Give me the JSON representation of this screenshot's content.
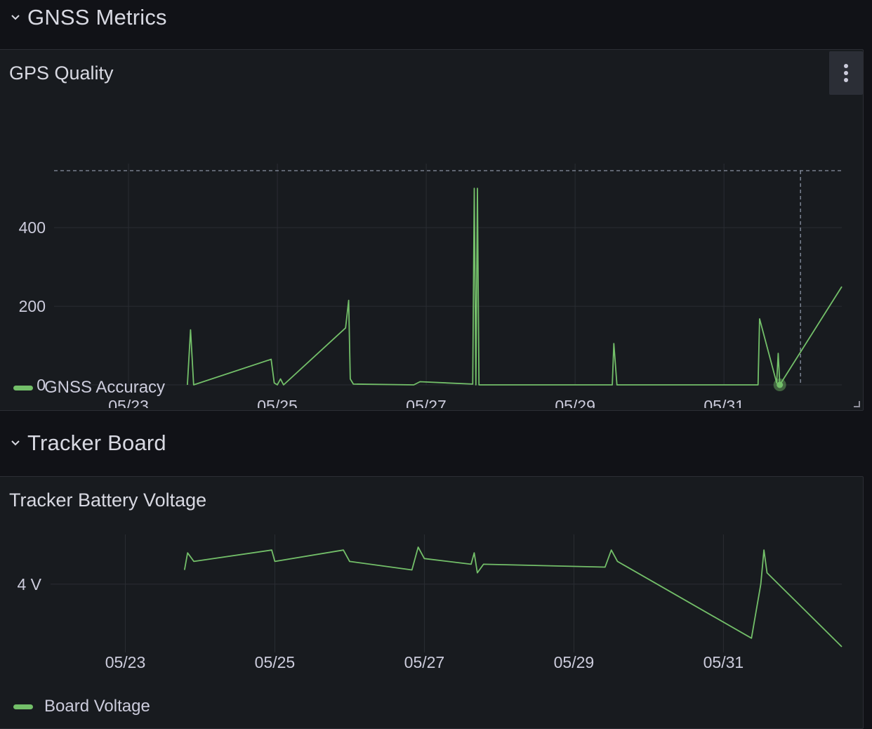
{
  "rows": [
    {
      "title": "GNSS Metrics"
    },
    {
      "title": "Tracker Board"
    }
  ],
  "panels": [
    {
      "title": "GPS Quality",
      "legend": "GNSS Accuracy"
    },
    {
      "title": "Tracker Battery Voltage",
      "legend": "Board Voltage"
    }
  ],
  "colors": {
    "background": "#111217",
    "panel": "#181b1f",
    "series": "#73bf69",
    "grid": "#2a2d33",
    "axis_text": "#ccccdc"
  },
  "icons": {
    "row_toggle": "chevron-down-icon",
    "panel_menu": "kebab-menu-icon"
  },
  "chart_data": [
    {
      "type": "line",
      "title": "GPS Quality",
      "x_ticks": [
        "05/23",
        "05/25",
        "05/27",
        "05/29",
        "05/31"
      ],
      "y_ticks": [
        "0",
        "200",
        "400"
      ],
      "ylim": [
        0,
        545
      ],
      "xlim": [
        "2023-05-22T00:00",
        "2023-06-01T14:00"
      ],
      "grid": true,
      "legend_position": "bottom-left",
      "threshold_dashed": 545,
      "hover_marker": {
        "x": "2023-05-31T18:00",
        "y": 0
      },
      "series": [
        {
          "name": "GNSS Accuracy",
          "points": [
            [
              "2023-05-23T19:00",
              0
            ],
            [
              "2023-05-23T20:00",
              140
            ],
            [
              "2023-05-23T21:00",
              0
            ],
            [
              "2023-05-24T22:00",
              65
            ],
            [
              "2023-05-24T23:00",
              5
            ],
            [
              "2023-05-25T00:00",
              0
            ],
            [
              "2023-05-25T01:00",
              15
            ],
            [
              "2023-05-25T02:00",
              0
            ],
            [
              "2023-05-25T22:00",
              145
            ],
            [
              "2023-05-25T23:00",
              215
            ],
            [
              "2023-05-25T23:30",
              15
            ],
            [
              "2023-05-26T00:30",
              2
            ],
            [
              "2023-05-26T20:00",
              0
            ],
            [
              "2023-05-26T22:00",
              8
            ],
            [
              "2023-05-27T15:00",
              2
            ],
            [
              "2023-05-27T15:30",
              500
            ],
            [
              "2023-05-27T16:00",
              0
            ],
            [
              "2023-05-27T16:30",
              500
            ],
            [
              "2023-05-27T17:00",
              0
            ],
            [
              "2023-05-29T12:00",
              0
            ],
            [
              "2023-05-29T12:30",
              105
            ],
            [
              "2023-05-29T13:30",
              0
            ],
            [
              "2023-05-31T11:00",
              0
            ],
            [
              "2023-05-31T11:30",
              168
            ],
            [
              "2023-05-31T17:00",
              5
            ],
            [
              "2023-05-31T17:30",
              80
            ],
            [
              "2023-05-31T18:00",
              0
            ],
            [
              "2023-06-01T14:00",
              250
            ]
          ]
        }
      ]
    },
    {
      "type": "line",
      "title": "Tracker Battery Voltage",
      "x_ticks": [
        "05/23",
        "05/25",
        "05/27",
        "05/29",
        "05/31"
      ],
      "y_ticks": [
        "4 V"
      ],
      "ylim": [
        3.76,
        4.15
      ],
      "xlim": [
        "2023-05-22T00:00",
        "2023-06-01T14:00"
      ],
      "grid": true,
      "legend_position": "bottom-left",
      "series": [
        {
          "name": "Board Voltage",
          "points": [
            [
              "2023-05-23T19:00",
              4.05
            ],
            [
              "2023-05-23T20:00",
              4.11
            ],
            [
              "2023-05-23T22:00",
              4.08
            ],
            [
              "2023-05-24T23:00",
              4.12
            ],
            [
              "2023-05-25T00:00",
              4.08
            ],
            [
              "2023-05-25T22:00",
              4.12
            ],
            [
              "2023-05-26T00:00",
              4.08
            ],
            [
              "2023-05-26T20:00",
              4.05
            ],
            [
              "2023-05-26T22:00",
              4.13
            ],
            [
              "2023-05-27T00:00",
              4.09
            ],
            [
              "2023-05-27T15:00",
              4.07
            ],
            [
              "2023-05-27T16:00",
              4.11
            ],
            [
              "2023-05-27T17:00",
              4.04
            ],
            [
              "2023-05-27T19:00",
              4.07
            ],
            [
              "2023-05-29T10:00",
              4.06
            ],
            [
              "2023-05-29T12:00",
              4.12
            ],
            [
              "2023-05-29T14:00",
              4.08
            ],
            [
              "2023-05-31T09:00",
              3.81
            ],
            [
              "2023-05-31T12:00",
              4.0
            ],
            [
              "2023-05-31T13:00",
              4.12
            ],
            [
              "2023-05-31T14:00",
              4.04
            ],
            [
              "2023-06-01T14:00",
              3.78
            ]
          ]
        }
      ]
    }
  ]
}
